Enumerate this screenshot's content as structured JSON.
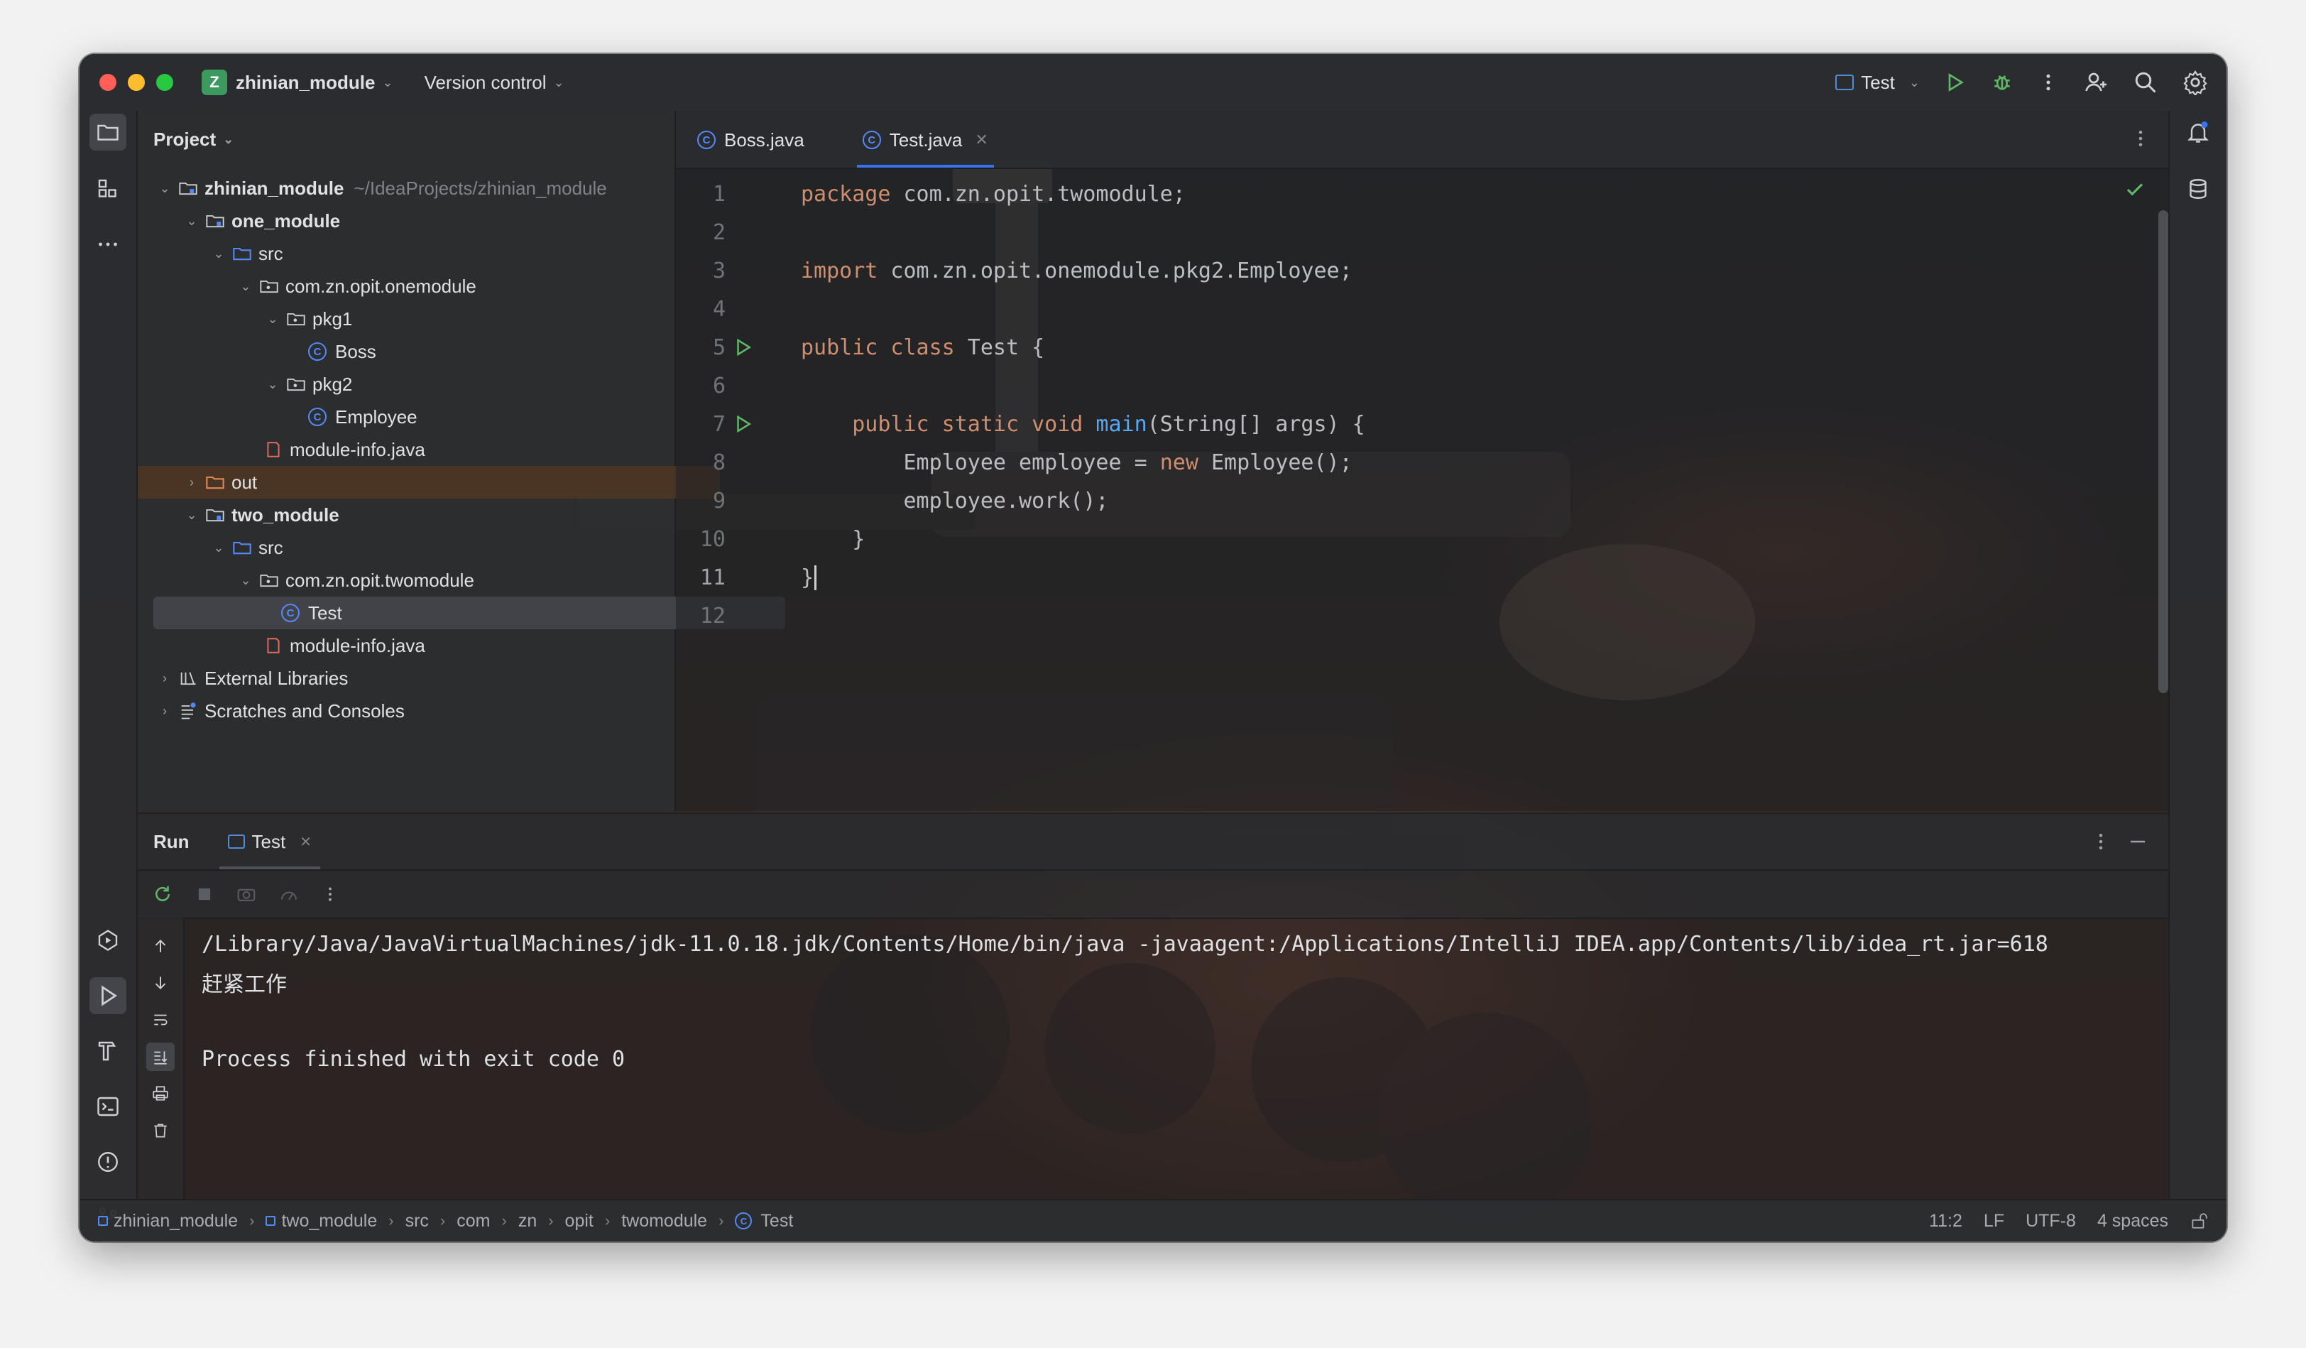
{
  "titlebar": {
    "project_badge": "Z",
    "project_name": "zhinian_module",
    "vcs_label": "Version control",
    "run_config": "Test"
  },
  "project_panel": {
    "title": "Project",
    "tree": [
      {
        "label": "zhinian_module",
        "path": "~/IdeaProjects/zhinian_module"
      },
      {
        "label": "one_module"
      },
      {
        "label": "src"
      },
      {
        "label": "com.zn.opit.onemodule"
      },
      {
        "label": "pkg1"
      },
      {
        "label": "Boss"
      },
      {
        "label": "pkg2"
      },
      {
        "label": "Employee"
      },
      {
        "label": "module-info.java"
      },
      {
        "label": "out"
      },
      {
        "label": "two_module"
      },
      {
        "label": "src"
      },
      {
        "label": "com.zn.opit.twomodule"
      },
      {
        "label": "Test"
      },
      {
        "label": "module-info.java"
      },
      {
        "label": "External Libraries"
      },
      {
        "label": "Scratches and Consoles"
      }
    ]
  },
  "editor": {
    "tabs": [
      {
        "label": "Boss.java"
      },
      {
        "label": "Test.java"
      }
    ],
    "line_numbers": [
      "1",
      "2",
      "3",
      "4",
      "5",
      "6",
      "7",
      "8",
      "9",
      "10",
      "11",
      "12"
    ],
    "code": {
      "l1_kw": "package",
      "l1_rest": " com.zn.opit.twomodule;",
      "l3_kw": "import",
      "l3_rest": " com.zn.opit.onemodule.pkg2.Employee;",
      "l5_kw": "public class",
      "l5_rest": " Test {",
      "l7_kw": "public static void",
      "l7_fn": "main",
      "l7_rest": "(String[] args) {",
      "l8_a": "Employee employee = ",
      "l8_kw": "new",
      "l8_b": " Employee();",
      "l9": "employee.work();",
      "l10": "}",
      "l11": "}"
    }
  },
  "run_panel": {
    "title": "Run",
    "tab": "Test",
    "console": [
      "/Library/Java/JavaVirtualMachines/jdk-11.0.18.jdk/Contents/Home/bin/java -javaagent:/Applications/IntelliJ IDEA.app/Contents/lib/idea_rt.jar=618",
      "赶紧工作",
      "",
      "Process finished with exit code 0"
    ]
  },
  "statusbar": {
    "breadcrumbs": [
      "zhinian_module",
      "two_module",
      "src",
      "com",
      "zn",
      "opit",
      "twomodule",
      "Test"
    ],
    "position": "11:2",
    "line_sep": "LF",
    "encoding": "UTF-8",
    "indent": "4 spaces"
  },
  "colors": {
    "accent": "#3574f0",
    "keyword": "#cf8e6d",
    "function": "#56a8f5",
    "run_green": "#57965c"
  }
}
